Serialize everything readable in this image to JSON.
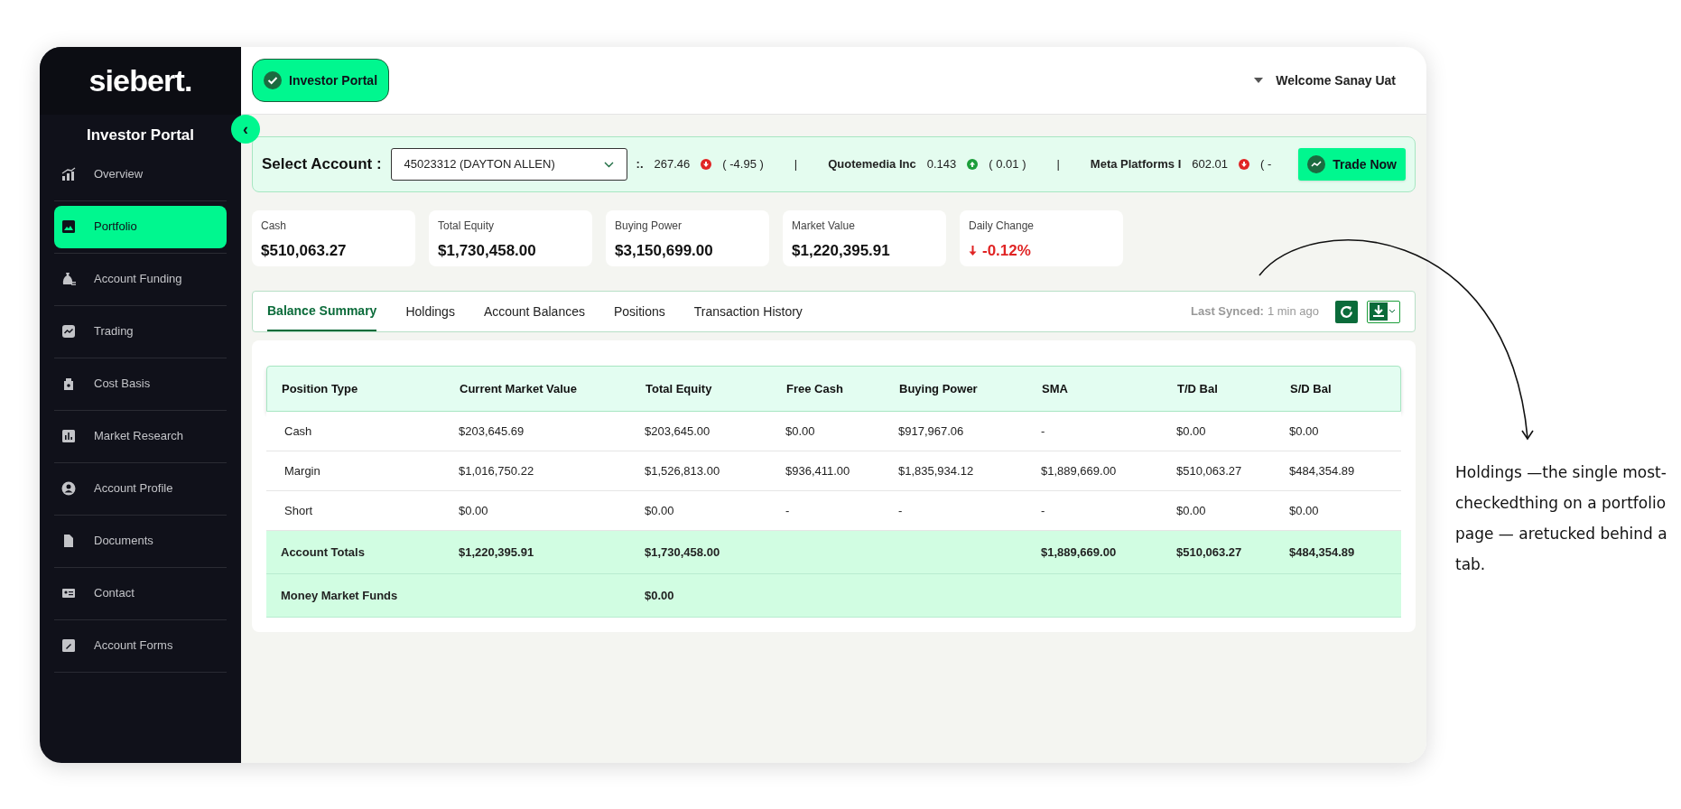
{
  "sidebar": {
    "logo": "siebert.",
    "title": "Investor Portal",
    "collapse_icon": "‹",
    "items": [
      {
        "label": "Overview",
        "kind": "chart",
        "selected": false
      },
      {
        "label": "Portfolio",
        "kind": "image",
        "selected": true
      },
      {
        "label": "Account Funding",
        "kind": "moneybag",
        "selected": false
      },
      {
        "label": "Trading",
        "kind": "trend",
        "selected": false
      },
      {
        "label": "Cost Basis",
        "kind": "bag",
        "selected": false
      },
      {
        "label": "Market Research",
        "kind": "bars",
        "selected": false
      },
      {
        "label": "Account Profile",
        "kind": "user",
        "selected": false
      },
      {
        "label": "Documents",
        "kind": "file",
        "selected": false
      },
      {
        "label": "Contact",
        "kind": "card",
        "selected": false
      },
      {
        "label": "Account Forms",
        "kind": "pencil",
        "selected": false
      }
    ]
  },
  "header": {
    "portal_button": "Investor Portal",
    "welcome": "Welcome Sanay Uat"
  },
  "account_bar": {
    "label": "Select Account :",
    "account": "45023312 (DAYTON ALLEN)",
    "tickers": [
      {
        "name": ":.",
        "price": "267.46",
        "kind": "down",
        "change": "( -4.95 )"
      },
      {
        "name": "Quotemedia Inc",
        "price": "0.143",
        "kind": "up",
        "change": "( 0.01 )"
      },
      {
        "name": "Meta Platforms I",
        "price": "602.01",
        "kind": "down",
        "change": "( -"
      }
    ],
    "separator": "|",
    "trade_button": "Trade Now"
  },
  "stats": [
    {
      "label": "Cash",
      "value": "$510,063.27",
      "kind": "plain"
    },
    {
      "label": "Total Equity",
      "value": "$1,730,458.00",
      "kind": "plain"
    },
    {
      "label": "Buying Power",
      "value": "$3,150,699.00",
      "kind": "plain"
    },
    {
      "label": "Market Value",
      "value": "$1,220,395.91",
      "kind": "plain"
    },
    {
      "label": "Daily Change",
      "value": "-0.12%",
      "kind": "down"
    }
  ],
  "tabs": [
    {
      "label": "Balance Summary",
      "selected": true
    },
    {
      "label": "Holdings",
      "selected": false
    },
    {
      "label": "Account Balances",
      "selected": false
    },
    {
      "label": "Positions",
      "selected": false
    },
    {
      "label": "Transaction History",
      "selected": false
    }
  ],
  "sync": {
    "label": "Last Synced:",
    "value": "1 min ago"
  },
  "table": {
    "columns": [
      "Position Type",
      "Current Market Value",
      "Total Equity",
      "Free Cash",
      "Buying Power",
      "SMA",
      "T/D Bal",
      "S/D Bal"
    ],
    "rows": [
      {
        "kind": "detail",
        "cells": [
          "Cash",
          "$203,645.69",
          "$203,645.00",
          "$0.00",
          "$917,967.06",
          "-",
          "$0.00",
          "$0.00"
        ]
      },
      {
        "kind": "detail",
        "cells": [
          "Margin",
          "$1,016,750.22",
          "$1,526,813.00",
          "$936,411.00",
          "$1,835,934.12",
          "$1,889,669.00",
          "$510,063.27",
          "$484,354.89"
        ]
      },
      {
        "kind": "detail",
        "cells": [
          "Short",
          "$0.00",
          "$0.00",
          "-",
          "-",
          "-",
          "$0.00",
          "$0.00"
        ]
      },
      {
        "kind": "total",
        "cells": [
          "Account Totals",
          "$1,220,395.91",
          "$1,730,458.00",
          "",
          "",
          "$1,889,669.00",
          "$510,063.27",
          "$484,354.89"
        ]
      },
      {
        "kind": "total",
        "cells": [
          "Money Market Funds",
          "",
          "$0.00",
          "",
          "",
          "",
          "",
          ""
        ]
      }
    ]
  },
  "annotation": "Holdings —the single most-checkedthing on a portfolio page — aretucked behind a tab."
}
